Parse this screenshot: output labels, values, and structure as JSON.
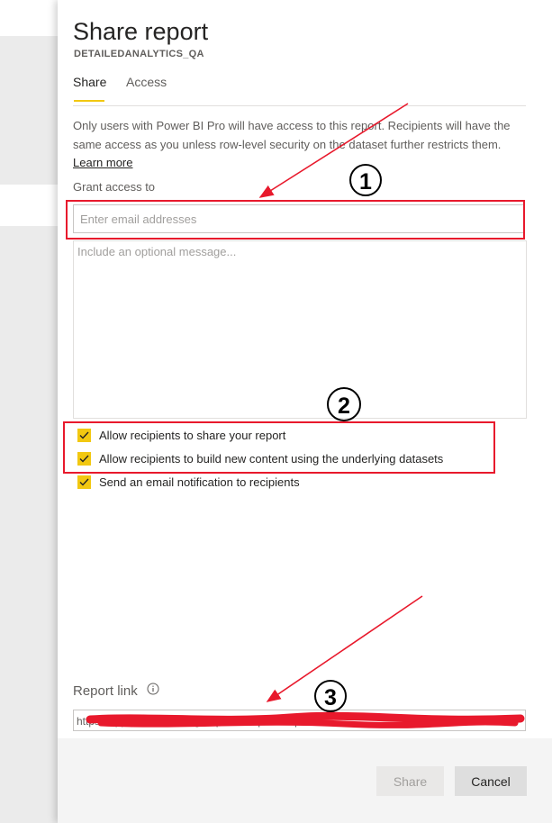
{
  "dialog": {
    "title": "Share report",
    "subtitle": "DETAILEDANALYTICS_QA",
    "tabs": [
      {
        "label": "Share",
        "active": true
      },
      {
        "label": "Access",
        "active": false
      }
    ],
    "info_text": "Only users with Power BI Pro will have access to this report. Recipients will have the same access as you unless row-level security on the dataset further restricts them.",
    "learn_more": "Learn more",
    "grant_label": "Grant access to",
    "email_placeholder": "Enter email addresses",
    "message_placeholder": "Include an optional message...",
    "options": [
      {
        "label": "Allow recipients to share your report",
        "checked": true
      },
      {
        "label": "Allow recipients to build new content using the underlying datasets",
        "checked": true
      },
      {
        "label": "Send an email notification to recipients",
        "checked": true
      }
    ],
    "report_link_label": "Report link",
    "report_link_value": "https://app.powerbi.com/groups/me/reports/report",
    "share_button": "Share",
    "cancel_button": "Cancel"
  },
  "annotations": {
    "markers": [
      "1",
      "2",
      "3"
    ]
  },
  "colors": {
    "accent": "#f2c811",
    "annotation": "#e8192c"
  }
}
